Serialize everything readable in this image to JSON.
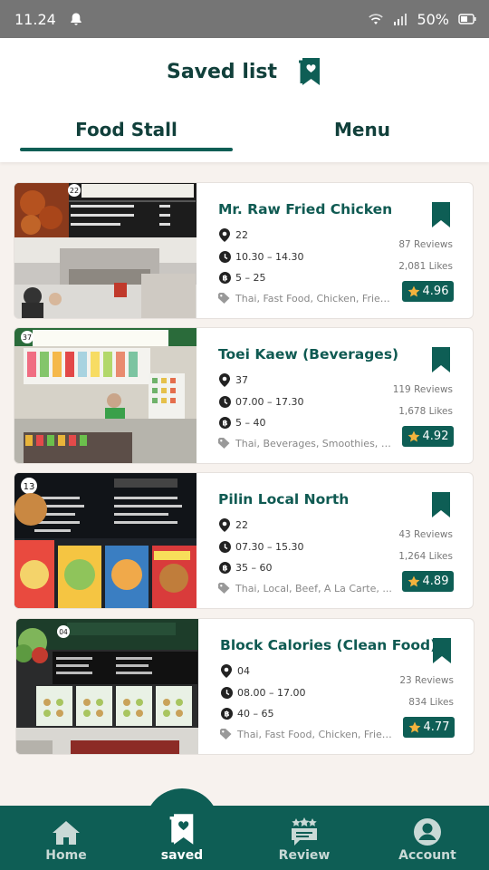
{
  "status_bar": {
    "time": "11.24",
    "battery": "50%"
  },
  "header": {
    "title": "Saved list"
  },
  "tabs": [
    {
      "label": "Food Stall",
      "active": true
    },
    {
      "label": "Menu",
      "active": false
    }
  ],
  "stalls": [
    {
      "name": "Mr. Raw Fried Chicken",
      "stall_no": "22",
      "hours": "10.30 – 14.30",
      "price": "5 – 25",
      "tags": "Thai, Fast Food, Chicken, Fried ...",
      "reviews": "87 Reviews",
      "likes": "2,081 Likes",
      "rating": "4.96",
      "photo_sign_no": "22"
    },
    {
      "name": "Toei Kaew (Beverages)",
      "stall_no": "37",
      "hours": "07.00 – 17.30",
      "price": "5 – 40",
      "tags": "Thai, Beverages, Smoothies, Fruit, ...",
      "reviews": "119 Reviews",
      "likes": "1,678 Likes",
      "rating": "4.92",
      "photo_sign_no": "37"
    },
    {
      "name": "Pilin Local North",
      "stall_no": "22",
      "hours": "07.30 – 15.30",
      "price": "35 – 60",
      "tags": "Thai, Local, Beef, A La Carte, ...",
      "reviews": "43 Reviews",
      "likes": "1,264 Likes",
      "rating": "4.89",
      "photo_sign_no": "13"
    },
    {
      "name": "Block Calories (Clean Food)",
      "stall_no": "04",
      "hours": "08.00 – 17.00",
      "price": "40 – 65",
      "tags": "Thai, Fast Food, Chicken, Fried ...",
      "reviews": "23 Reviews",
      "likes": "834 Likes",
      "rating": "4.77",
      "photo_sign_no": "04"
    }
  ],
  "bottom_nav": [
    {
      "label": "Home",
      "icon": "home-icon"
    },
    {
      "label": "saved",
      "icon": "bookmark-heart-icon",
      "active": true
    },
    {
      "label": "Review",
      "icon": "review-stars-icon"
    },
    {
      "label": "Account",
      "icon": "account-icon"
    }
  ],
  "colors": {
    "primary": "#0e5e55",
    "title": "#11403b",
    "background": "#f7f2ee",
    "status_bar": "#757575"
  }
}
